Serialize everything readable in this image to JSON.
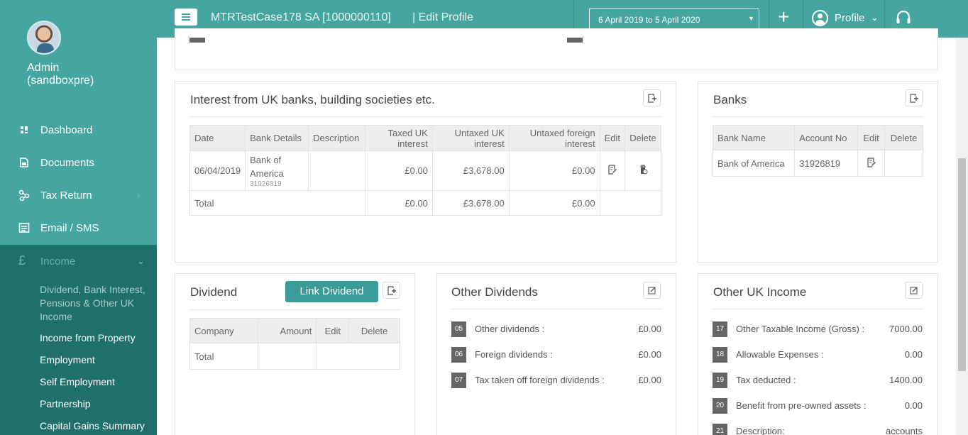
{
  "sidebar": {
    "admin_name": "Admin\n(sandboxpre)",
    "nav": [
      {
        "label": "Dashboard"
      },
      {
        "label": "Documents"
      },
      {
        "label": "Tax Return"
      },
      {
        "label": "Email / SMS"
      },
      {
        "label": "Income"
      }
    ],
    "income_sub": [
      {
        "label": "Dividend, Bank Interest, Pensions & Other UK Income"
      },
      {
        "label": "Income from Property"
      },
      {
        "label": "Employment"
      },
      {
        "label": "Self Employment"
      },
      {
        "label": "Partnership"
      },
      {
        "label": "Capital Gains Summary"
      }
    ]
  },
  "topbar": {
    "client": "MTRTestCase178 SA [1000000110]",
    "section": "| Edit Profile",
    "date_range": "6 April 2019 to 5 April 2020",
    "profile_label": "Profile"
  },
  "interest": {
    "title": "Interest from UK banks, building societies etc.",
    "headers": [
      "Date",
      "Bank Details",
      "Description",
      "Taxed UK interest",
      "Untaxed UK interest",
      "Untaxed foreign interest",
      "Edit",
      "Delete"
    ],
    "row": {
      "date": "06/04/2019",
      "bank": "Bank of America",
      "account": "31926819",
      "description": "",
      "taxed": "£0.00",
      "untaxed": "£3,678.00",
      "foreign": "£0.00"
    },
    "total": {
      "label": "Total",
      "taxed": "£0.00",
      "untaxed": "£3,678.00",
      "foreign": "£0.00"
    }
  },
  "banks": {
    "title": "Banks",
    "headers": [
      "Bank Name",
      "Account No",
      "Edit",
      "Delete"
    ],
    "row": {
      "name": "Bank of America",
      "account": "31926819"
    }
  },
  "dividend": {
    "title": "Dividend",
    "link_button": "Link Dividend",
    "headers": [
      "Company",
      "Amount",
      "Edit",
      "Delete"
    ],
    "total_label": "Total"
  },
  "other_dividends": {
    "title": "Other Dividends",
    "items": [
      {
        "num": "05",
        "label": "Other dividends :",
        "value": "£0.00"
      },
      {
        "num": "06",
        "label": "Foreign dividends :",
        "value": "£0.00"
      },
      {
        "num": "07",
        "label": "Tax taken off foreign dividends :",
        "value": "£0.00"
      }
    ]
  },
  "other_uk_income": {
    "title": "Other UK Income",
    "items": [
      {
        "num": "17",
        "label": "Other Taxable Income (Gross) :",
        "value": "7000.00"
      },
      {
        "num": "18",
        "label": "Allowable Expenses :",
        "value": "0.00"
      },
      {
        "num": "19",
        "label": "Tax deducted :",
        "value": "1400.00"
      },
      {
        "num": "20",
        "label": "Benefit from pre-owned assets :",
        "value": "0.00"
      },
      {
        "num": "21",
        "label": "Description:",
        "value": "accounts"
      }
    ]
  },
  "colors": {
    "brand": "#45a5a0",
    "brand_dark": "#1f6f6b",
    "button": "#3a9c98"
  }
}
